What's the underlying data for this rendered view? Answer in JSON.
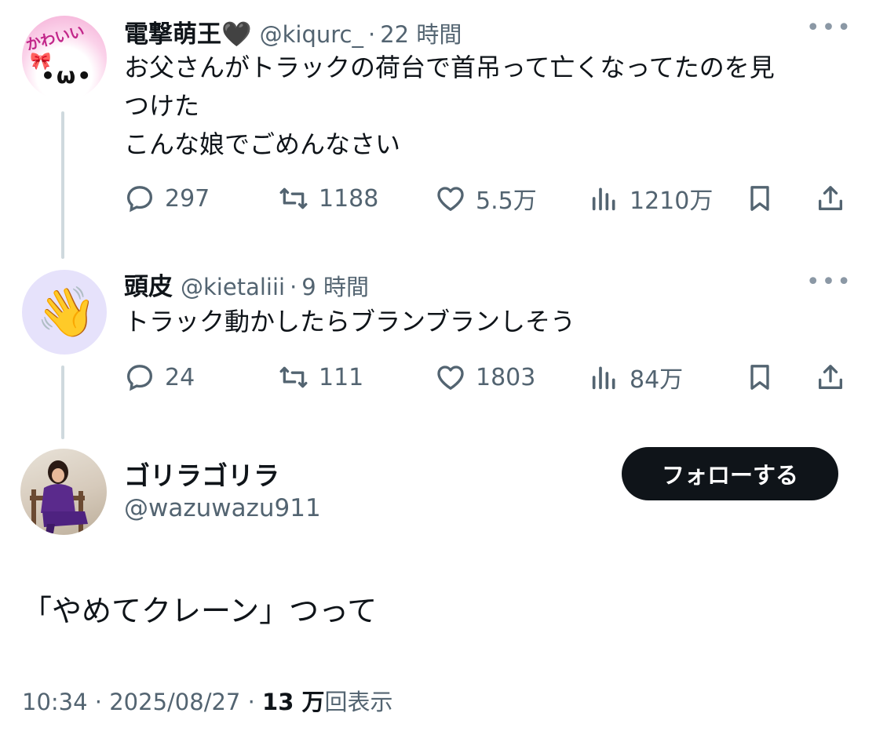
{
  "reply1": {
    "name": "電撃萌王🖤",
    "handle": "@kiqurc_",
    "separator": "·",
    "time": "22 時間",
    "text_line1": "お父さんがトラックの荷台で首吊って亡くなってたのを見",
    "text_line2": "つけた",
    "text_line3": "こんな娘でごめんなさい",
    "avatar_text": "かわいい",
    "avatar_face": "•ω•",
    "replies": "297",
    "retweets": "1188",
    "likes": "5.5万",
    "views": "1210万"
  },
  "reply2": {
    "name": "頭皮",
    "handle": "@kietaliii",
    "separator": "·",
    "time": "9 時間",
    "text": "トラック動かしたらブランブランしそう",
    "replies": "24",
    "retweets": "111",
    "likes": "1803",
    "views": "84万"
  },
  "main": {
    "name": "ゴリラゴリラ",
    "handle": "@wazuwazu911",
    "follow_label": "フォローする",
    "text": "「やめてクレーン」つって"
  },
  "footer": {
    "time": "10:34",
    "separator": "·",
    "date": "2025/08/27",
    "views_count": "13 万",
    "views_label": "回表示"
  },
  "icons": {
    "reply": "reply-icon",
    "retweet": "retweet-icon",
    "like": "heart-icon",
    "views": "views-icon",
    "bookmark": "bookmark-icon",
    "share": "share-icon",
    "more": "more-icon"
  },
  "colors": {
    "text": "#0f1419",
    "secondary": "#536471",
    "thread_line": "#cfd9de",
    "button_bg": "#0f1419"
  }
}
